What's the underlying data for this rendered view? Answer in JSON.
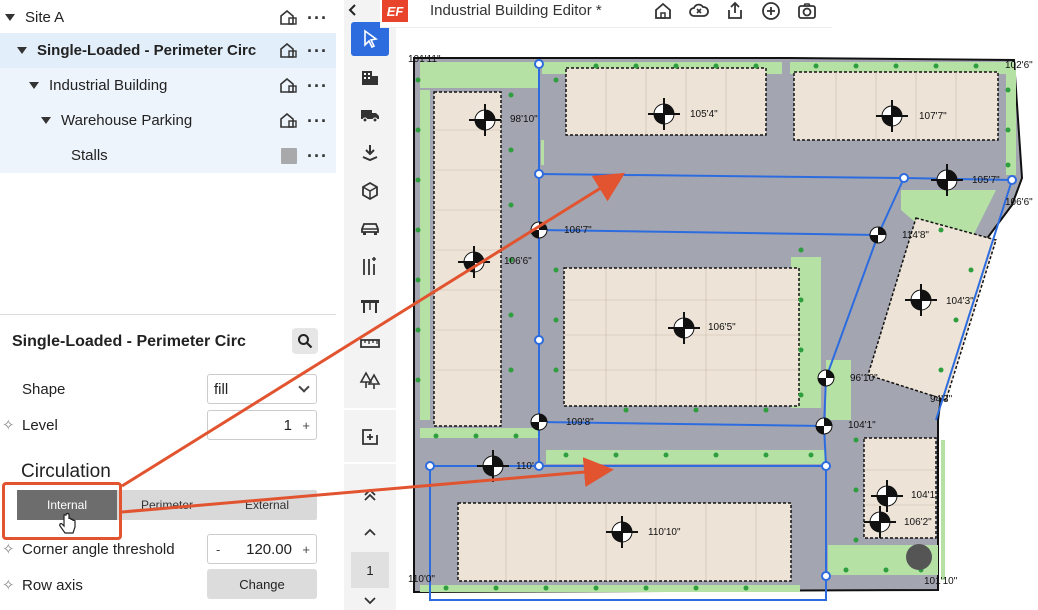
{
  "tree": {
    "items": [
      {
        "label": "Site A"
      },
      {
        "label": "Single-Loaded - Perimeter Circ"
      },
      {
        "label": "Industrial Building"
      },
      {
        "label": "Warehouse Parking"
      },
      {
        "label": "Stalls"
      }
    ]
  },
  "props": {
    "title": "Single-Loaded - Perimeter Circ",
    "shape_label": "Shape",
    "shape_value": "fill",
    "level_label": "Level",
    "level_minus": "-",
    "level_value": "1",
    "level_plus": "+",
    "circulation_heading": "Circulation",
    "circ_options": [
      "Internal",
      "Perimeter",
      "External"
    ],
    "circ_selected": "Internal",
    "corner_label": "Corner angle threshold",
    "corner_minus": "-",
    "corner_value": "120.00",
    "corner_plus": "+",
    "row_axis_label": "Row axis",
    "row_axis_button": "Change"
  },
  "header": {
    "logo": "EF",
    "title": "Industrial Building Editor *",
    "icons": [
      "home-icon",
      "cloud-off-icon",
      "share-icon",
      "add-circle-icon",
      "camera-icon"
    ]
  },
  "toolbar": {
    "page_number": "1"
  },
  "canvas": {
    "dims": [
      "101'11\"",
      "102'6\"",
      "98'10\"",
      "105'4\"",
      "107'7\"",
      "105'7\"",
      "106'6\"",
      "106'7\"",
      "114'8\"",
      "106'6\"",
      "104'3\"",
      "106'5\"",
      "96'10\"",
      "94'3\"",
      "109'8\"",
      "104'1\"",
      "110'",
      "104'1\"",
      "110'10\"",
      "106'2\"",
      "110'0\"",
      "101'10\""
    ]
  },
  "colors": {
    "accent": "#2d6cdf",
    "highlight": "#e2542f",
    "road": "#a3a5b1",
    "grass": "#b5e2a4",
    "building": "#ede3d6"
  }
}
